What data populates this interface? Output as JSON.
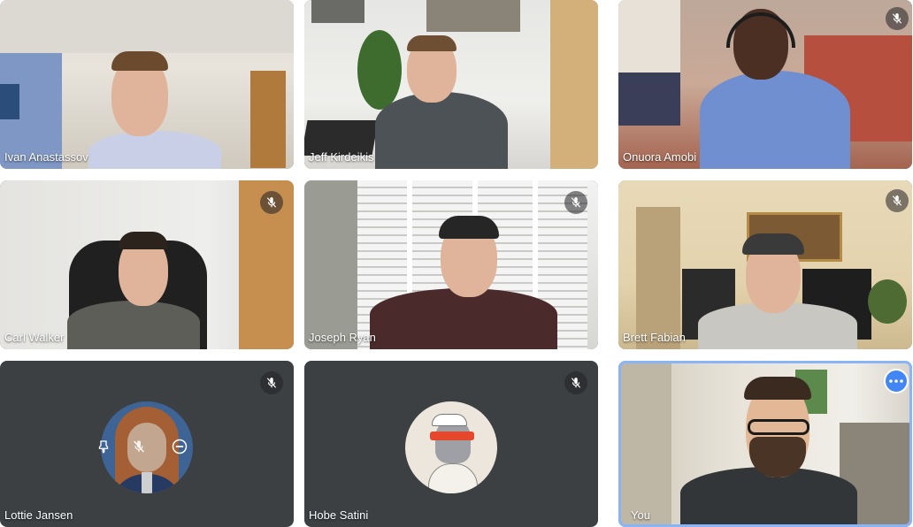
{
  "participants": [
    {
      "name": "Ivan Anastassov",
      "muted": false
    },
    {
      "name": "Jeff Kirdeikis",
      "muted": false
    },
    {
      "name": "Onuora Amobi",
      "muted": true
    },
    {
      "name": "Carl Walker",
      "muted": true
    },
    {
      "name": "Joseph Ryan",
      "muted": true
    },
    {
      "name": "Brett Fabian",
      "muted": true
    },
    {
      "name": "Lottie Jansen",
      "muted": true,
      "avatar": true
    },
    {
      "name": "Hobe Satini",
      "muted": true,
      "avatar": true
    },
    {
      "name": "You",
      "muted": false,
      "self": true
    }
  ],
  "icons": {
    "mic_off": "mic-off-icon",
    "more": "more-options-icon",
    "pin": "pin-icon",
    "remove": "remove-icon"
  },
  "colors": {
    "tile_bg": "#3c4043",
    "self_border": "#8ab4f8",
    "more_button": "#4285f4"
  }
}
